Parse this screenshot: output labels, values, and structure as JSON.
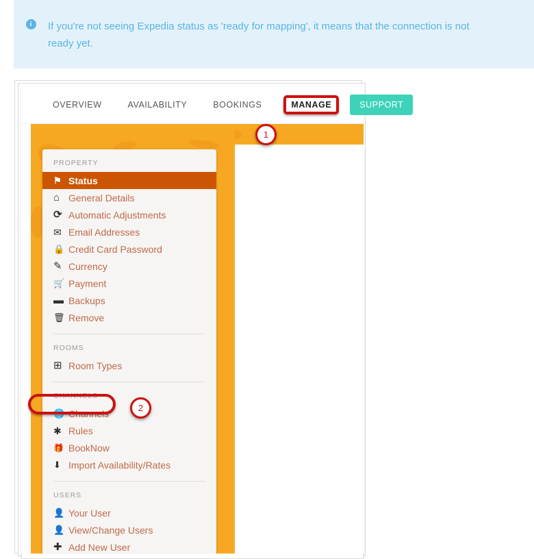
{
  "banner": {
    "icon": "info-circle-icon",
    "icon_glyph": "i",
    "text": "If you're not seeing Expedia status as 'ready for mapping', it means that the connection is not ready yet.",
    "background_color": "#e3f2fa",
    "text_color": "#5bb4e5"
  },
  "tabs": [
    {
      "label": "OVERVIEW",
      "style": "link"
    },
    {
      "label": "AVAILABILITY",
      "style": "link"
    },
    {
      "label": "BOOKINGS",
      "style": "link"
    },
    {
      "label": "MANAGE",
      "style": "highlighted"
    },
    {
      "label": "SUPPORT",
      "style": "button"
    }
  ],
  "support_button_color": "#3ed3b8",
  "callouts": [
    {
      "number": "1",
      "target": "MANAGE"
    },
    {
      "number": "2",
      "target": "Channels"
    }
  ],
  "highlight_color": "#cc1111",
  "sidebar": {
    "active_item_color": "#cb5502",
    "background_color": "#f7a823",
    "sections": [
      {
        "heading": "PROPERTY",
        "items": [
          {
            "label": "Status",
            "icon": "flag-icon",
            "active": true
          },
          {
            "label": "General Details",
            "icon": "home-icon",
            "active": false
          },
          {
            "label": "Automatic Adjustments",
            "icon": "refresh-icon",
            "active": false
          },
          {
            "label": "Email Addresses",
            "icon": "mail-icon",
            "active": false
          },
          {
            "label": "Credit Card Password",
            "icon": "lock-icon",
            "active": false
          },
          {
            "label": "Currency",
            "icon": "edit-icon",
            "active": false
          },
          {
            "label": "Payment",
            "icon": "cart-icon",
            "active": false
          },
          {
            "label": "Backups",
            "icon": "disk-icon",
            "active": false
          },
          {
            "label": "Remove",
            "icon": "trash-icon",
            "active": false
          }
        ]
      },
      {
        "heading": "ROOMS",
        "items": [
          {
            "label": "Room Types",
            "icon": "grid-icon",
            "active": false
          }
        ]
      },
      {
        "heading": "CHANNELS",
        "items": [
          {
            "label": "Channels",
            "icon": "globe-icon",
            "active": false,
            "marked": true
          },
          {
            "label": "Rules",
            "icon": "asterisk-icon",
            "active": false
          },
          {
            "label": "BookNow",
            "icon": "gift-icon",
            "active": false
          },
          {
            "label": "Import Availability/Rates",
            "icon": "download-icon",
            "active": false
          }
        ]
      },
      {
        "heading": "USERS",
        "items": [
          {
            "label": "Your User",
            "icon": "user-icon",
            "active": false
          },
          {
            "label": "View/Change Users",
            "icon": "user-icon",
            "active": false
          },
          {
            "label": "Add New User",
            "icon": "plus-icon",
            "active": false
          }
        ]
      }
    ]
  }
}
